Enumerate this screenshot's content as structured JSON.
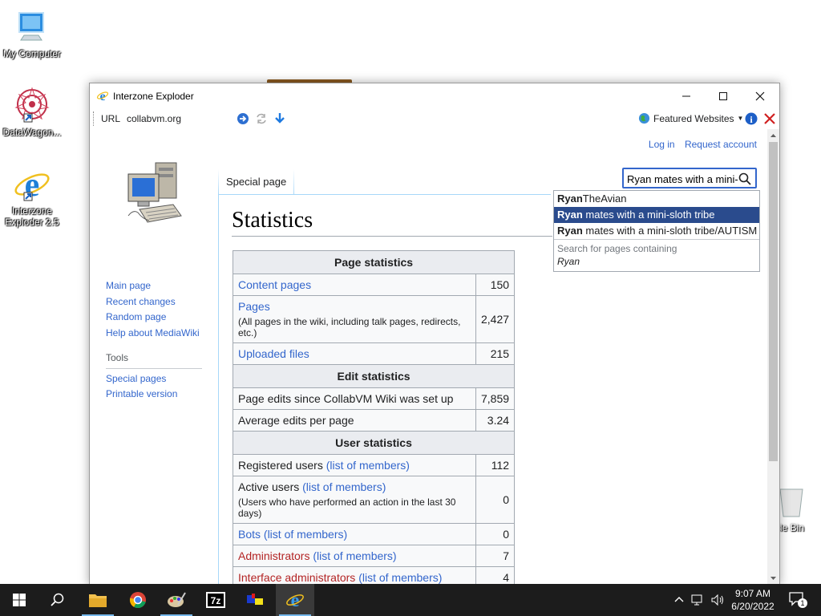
{
  "desktop": {
    "icons": [
      {
        "label": "My Computer"
      },
      {
        "label": "DataWagon..."
      },
      {
        "label": "Interzone Exploder 2.5"
      }
    ],
    "recycle_label": "cle Bin"
  },
  "window": {
    "title": "Interzone Exploder",
    "url_label": "URL",
    "url_value": "collabvm.org",
    "featured": "Featured Websites"
  },
  "page": {
    "top_links": [
      "Log in",
      "Request account"
    ],
    "tab": "Special page",
    "title": "Statistics",
    "search": {
      "value": "Ryan mates with a mini-",
      "suggestions": [
        {
          "bold": "Ryan",
          "rest": "TheAvian"
        },
        {
          "bold": "Ryan",
          "rest": " mates with a mini-sloth tribe"
        },
        {
          "bold": "Ryan",
          "rest": " mates with a mini-sloth tribe/AUTISM"
        }
      ],
      "search_containing": "Search for pages containing",
      "search_term": "Ryan"
    },
    "sidebar": {
      "nav": [
        "Main page",
        "Recent changes",
        "Random page",
        "Help about MediaWiki"
      ],
      "tools_heading": "Tools",
      "tools": [
        "Special pages",
        "Printable version"
      ]
    },
    "stats": {
      "page_header": "Page statistics",
      "content_pages": "Content pages",
      "content_pages_val": "150",
      "pages": "Pages",
      "pages_note": "(All pages in the wiki, including talk pages, redirects, etc.)",
      "pages_val": "2,427",
      "uploaded": "Uploaded files",
      "uploaded_val": "215",
      "edit_header": "Edit statistics",
      "edits_since": "Page edits since CollabVM Wiki was set up",
      "edits_since_val": "7,859",
      "avg_edits": "Average edits per page",
      "avg_edits_val": "3.24",
      "user_header": "User statistics",
      "registered": "Registered users",
      "registered_link": "(list of members)",
      "registered_val": "112",
      "active": "Active users",
      "active_link": "(list of members)",
      "active_note": "(Users who have performed an action in the last 30 days)",
      "active_val": "0",
      "bots": "Bots",
      "bots_link": "(list of members)",
      "bots_val": "0",
      "admins": "Administrators",
      "admins_link": "(list of members)",
      "admins_val": "7",
      "iface_admins": "Interface administrators",
      "iface_link": "(list of members)",
      "iface_val": "4"
    }
  },
  "taskbar": {
    "time": "9:07 AM",
    "date": "6/20/2022",
    "notif_count": "1"
  },
  "colors": {
    "link": "#3366cc",
    "redlink": "#b32424",
    "suggest_selected": "#2a4b8d",
    "taskbar": "#1c1c1c"
  }
}
